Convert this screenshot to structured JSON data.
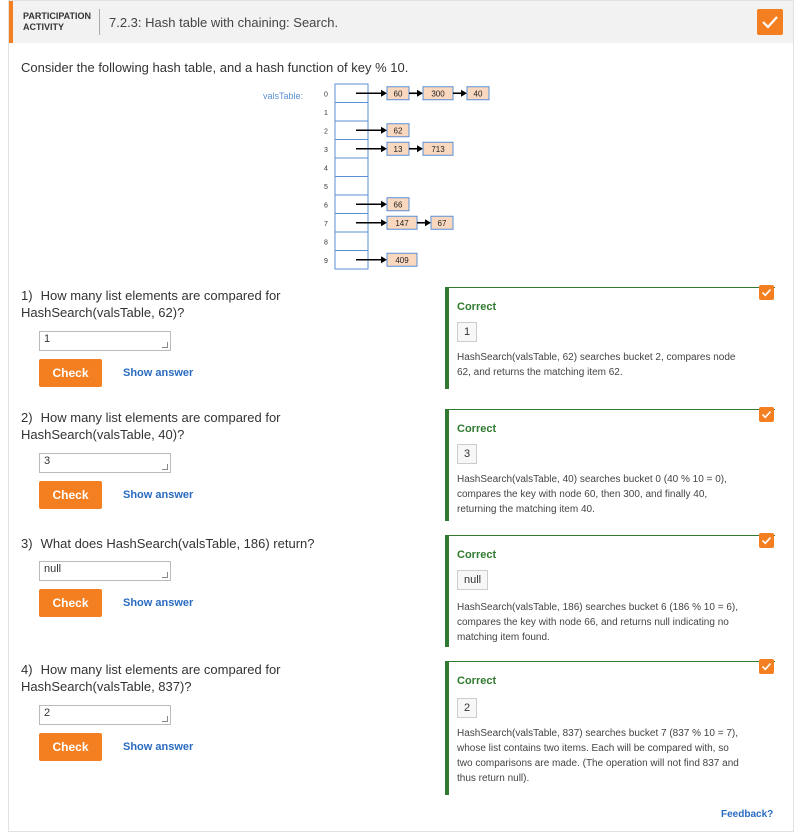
{
  "header": {
    "tag": "PARTICIPATION ACTIVITY",
    "title": "7.2.3: Hash table with chaining: Search."
  },
  "intro": "Consider the following hash table, and a hash function of key % 10.",
  "diagram": {
    "table_label": "valsTable:",
    "buckets": [
      "0",
      "1",
      "2",
      "3",
      "4",
      "5",
      "6",
      "7",
      "8",
      "9"
    ],
    "chains": {
      "0": [
        "60",
        "300",
        "40"
      ],
      "2": [
        "62"
      ],
      "3": [
        "13",
        "713"
      ],
      "6": [
        "66"
      ],
      "7": [
        "147",
        "67"
      ],
      "9": [
        "409"
      ]
    }
  },
  "questions": [
    {
      "num": "1)",
      "text": "How many list elements are compared for HashSearch(valsTable, 62)?",
      "answer": "1",
      "check": "Check",
      "show": "Show answer",
      "status": "Correct",
      "value": "1",
      "explanation": "HashSearch(valsTable, 62) searches bucket 2, compares node 62, and returns the matching item 62."
    },
    {
      "num": "2)",
      "text": "How many list elements are compared for HashSearch(valsTable, 40)?",
      "answer": "3",
      "check": "Check",
      "show": "Show answer",
      "status": "Correct",
      "value": "3",
      "explanation": "HashSearch(valsTable, 40) searches bucket 0 (40 % 10 = 0), compares the key with node 60, then 300, and finally 40, returning the matching item 40."
    },
    {
      "num": "3)",
      "text": "What does HashSearch(valsTable, 186) return?",
      "answer": "null",
      "check": "Check",
      "show": "Show answer",
      "status": "Correct",
      "value": "null",
      "explanation": "HashSearch(valsTable, 186) searches bucket 6 (186 % 10 = 6), compares the key with node 66, and returns null indicating no matching item found."
    },
    {
      "num": "4)",
      "text": "How many list elements are compared for HashSearch(valsTable, 837)?",
      "answer": "2",
      "check": "Check",
      "show": "Show answer",
      "status": "Correct",
      "value": "2",
      "explanation": "HashSearch(valsTable, 837) searches bucket 7 (837 % 10 = 7), whose list contains two items. Each will be compared with, so two comparisons are made. (The operation will not find 837 and thus return null)."
    }
  ],
  "footer": {
    "feedback": "Feedback?"
  },
  "colors": {
    "accent": "#f47f20",
    "correct": "#2f7a2f",
    "link": "#2a6bbf",
    "node_fill": "#f9d8bf",
    "node_border": "#5a8fd6"
  },
  "icons": {
    "header_done": "checkmark-icon",
    "question_done": "checkmark-icon"
  }
}
